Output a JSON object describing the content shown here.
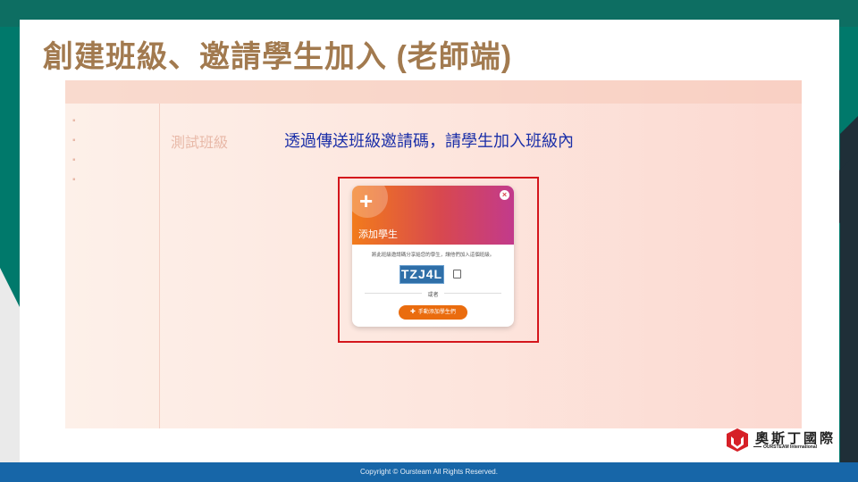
{
  "slide": {
    "title": "創建班級、邀請學生加入 (老師端)",
    "caption": "透過傳送班級邀請碼，請學生加入班級內",
    "footer": "Copyright © Oursteam All Rights Reserved."
  },
  "dialog": {
    "title": "添加學生",
    "description": "將此班級邀請碼分享給您的學生，讓他們加入這個班級。",
    "invite_code": "TZJ4L",
    "or_label": "或者",
    "add_button": "手動添加學生們"
  },
  "logo": {
    "name_cn": "奧斯丁國際",
    "name_en": "OURSTEAM International"
  },
  "background_app": {
    "heading": "測試班級"
  },
  "colors": {
    "title": "#a27a4f",
    "caption": "#1b2fa8",
    "highlight": "#d4161c",
    "button": "#ea6c0e",
    "footer": "#1766a8"
  }
}
